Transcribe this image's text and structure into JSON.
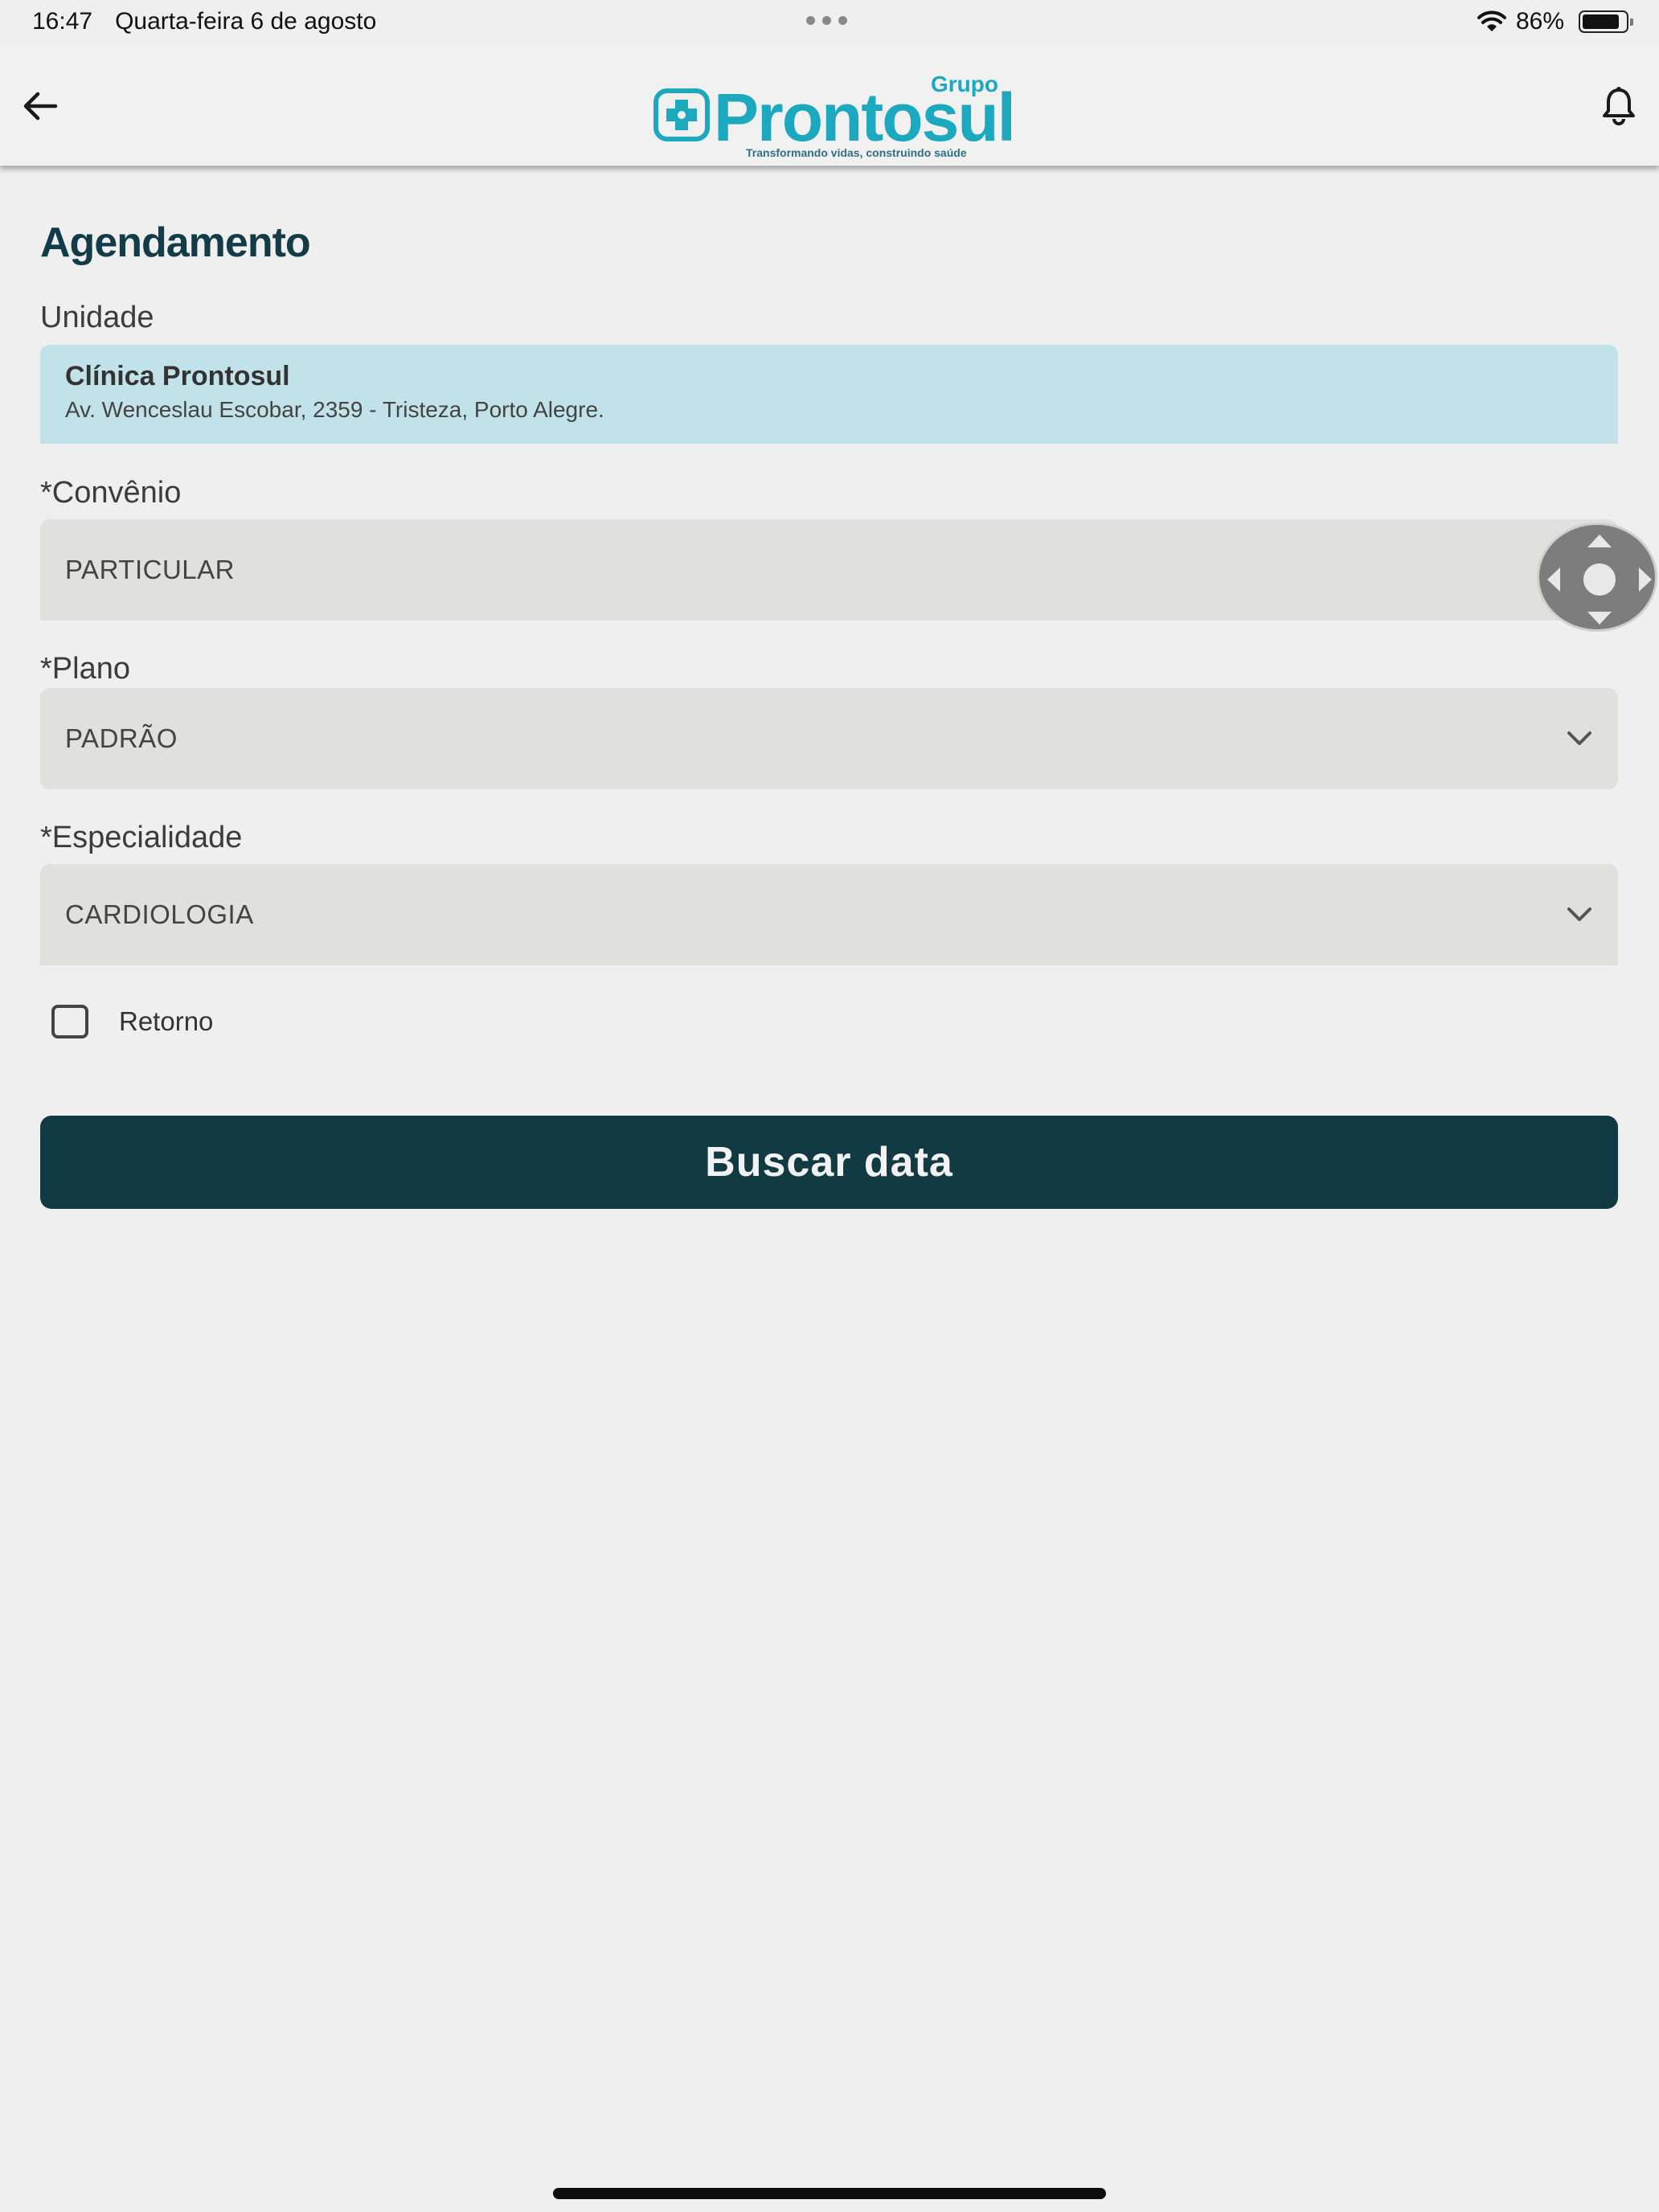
{
  "status_bar": {
    "time": "16:47",
    "date": "Quarta-feira 6 de agosto",
    "battery_percent": "86%",
    "battery_level": 0.86
  },
  "header": {
    "logo_brand": "Prontosul",
    "logo_group": "Grupo",
    "logo_tagline": "Transformando vidas, construindo saúde",
    "icons": [
      "arrow-left-icon",
      "bell-icon"
    ],
    "brand_color": "#1ca8be"
  },
  "page": {
    "title": "Agendamento"
  },
  "form": {
    "unit": {
      "label": "Unidade",
      "name": "Clínica Prontosul",
      "address": "Av. Wenceslau Escobar, 2359 - Tristeza, Porto Alegre."
    },
    "convenio": {
      "label": "*Convênio",
      "value": "PARTICULAR"
    },
    "plano": {
      "label": "*Plano",
      "value": "PADRÃO"
    },
    "especialidade": {
      "label": "*Especialidade",
      "value": "CARDIOLOGIA"
    },
    "retorno": {
      "label": "Retorno",
      "checked": false
    },
    "submit_label": "Buscar data"
  },
  "colors": {
    "primary_button": "#113a43",
    "unit_box": "#c1e2e8",
    "select_bg": "#e0e0de",
    "title": "#123c47"
  }
}
